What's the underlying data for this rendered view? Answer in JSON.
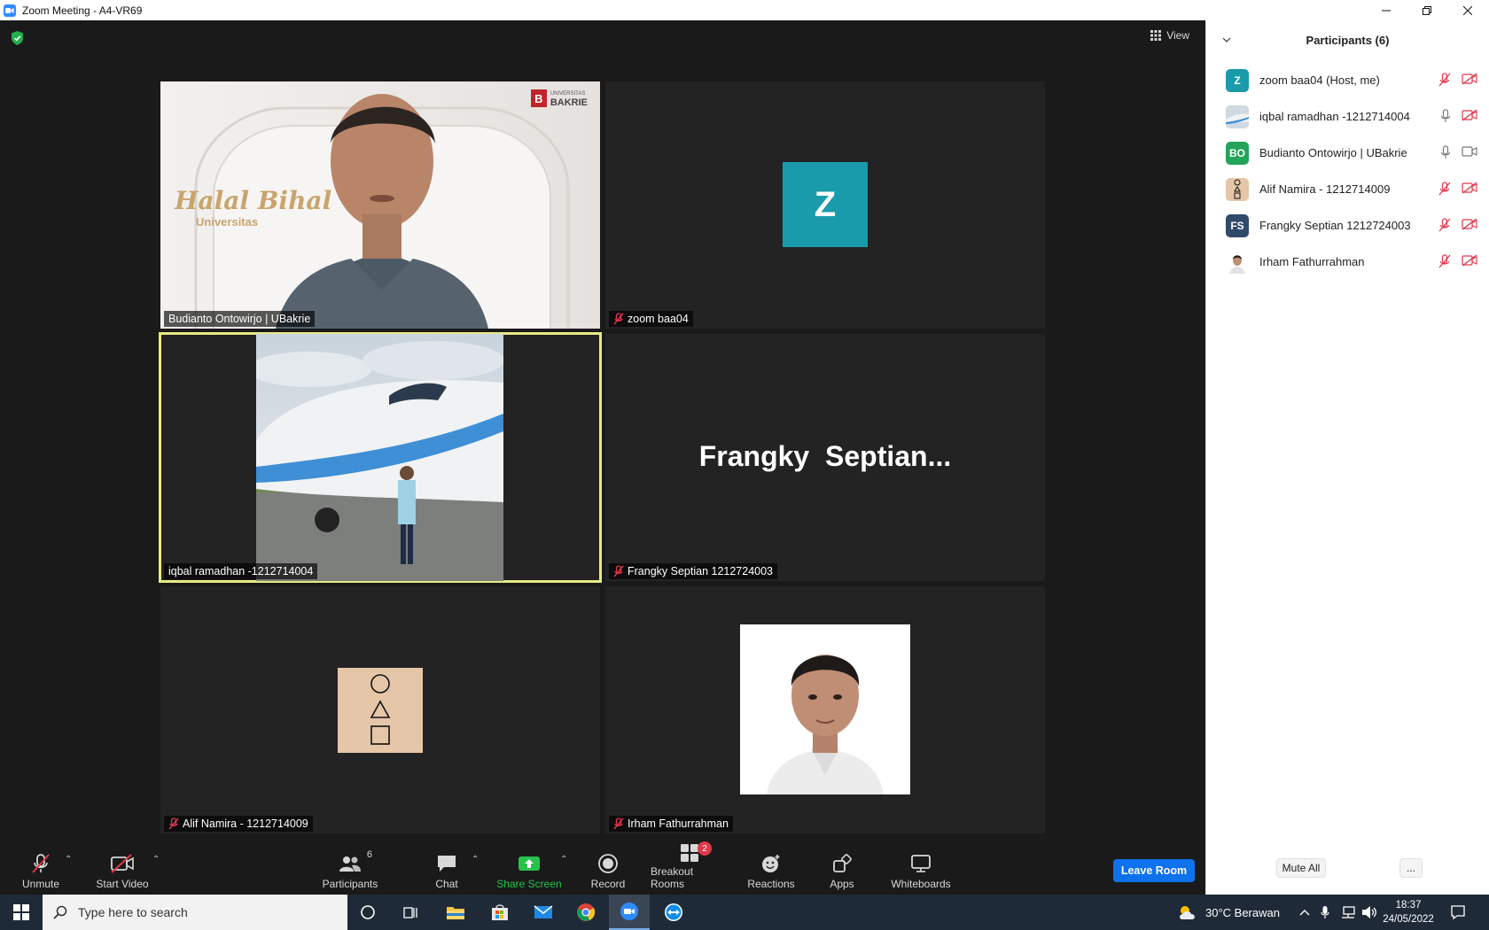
{
  "window": {
    "title": "Zoom Meeting - A4-VR69"
  },
  "meeting": {
    "view_label": "View",
    "tiles": [
      {
        "name": "Budianto Ontowirjo | UBakrie",
        "banner_text": "Halal Bihal",
        "banner_sub": "Universitas",
        "logo_univ": "UNIVERSITAS",
        "logo_name": "BAKRIE",
        "muted": false
      },
      {
        "name": "zoom baa04",
        "initial": "Z",
        "muted": true
      },
      {
        "name": "iqbal ramadhan -1212714004",
        "muted": false,
        "active_speaker": true
      },
      {
        "name": "Frangky Septian 1212724003",
        "display_text": "Frangky  Septian...",
        "muted": true
      },
      {
        "name": "Alif Namira - 1212714009",
        "muted": true
      },
      {
        "name": "Irham Fathurrahman",
        "muted": true
      }
    ]
  },
  "toolbar": {
    "unmute": "Unmute",
    "start_video": "Start Video",
    "participants": "Participants",
    "participants_count": "6",
    "chat": "Chat",
    "share_screen": "Share Screen",
    "record": "Record",
    "breakout_rooms": "Breakout Rooms",
    "breakout_badge": "2",
    "reactions": "Reactions",
    "apps": "Apps",
    "whiteboards": "Whiteboards",
    "leave": "Leave Room"
  },
  "participants_panel": {
    "title": "Participants (6)",
    "items": [
      {
        "name": "zoom baa04 (Host, me)",
        "initials": "Z",
        "color": "#1a9bab",
        "mic": "muted",
        "video": "off"
      },
      {
        "name": "iqbal ramadhan -1212714004",
        "initials": "",
        "color": "#8aa2b8",
        "mic": "on",
        "video": "off"
      },
      {
        "name": "Budianto Ontowirjo | UBakrie",
        "initials": "BO",
        "color": "#23a35a",
        "mic": "on",
        "video": "on"
      },
      {
        "name": "Alif Namira - 1212714009",
        "initials": "",
        "color": "#e6c6a8",
        "mic": "muted",
        "video": "off"
      },
      {
        "name": "Frangky Septian 1212724003",
        "initials": "FS",
        "color": "#2f4a6b",
        "mic": "muted",
        "video": "off"
      },
      {
        "name": "Irham Fathurrahman",
        "initials": "",
        "color": "#eeeeee",
        "mic": "muted",
        "video": "off"
      }
    ],
    "mute_all": "Mute All",
    "more": "..."
  },
  "taskbar": {
    "search_placeholder": "Type here to search",
    "weather": "30°C  Berawan",
    "time": "18:37",
    "date": "24/05/2022"
  }
}
